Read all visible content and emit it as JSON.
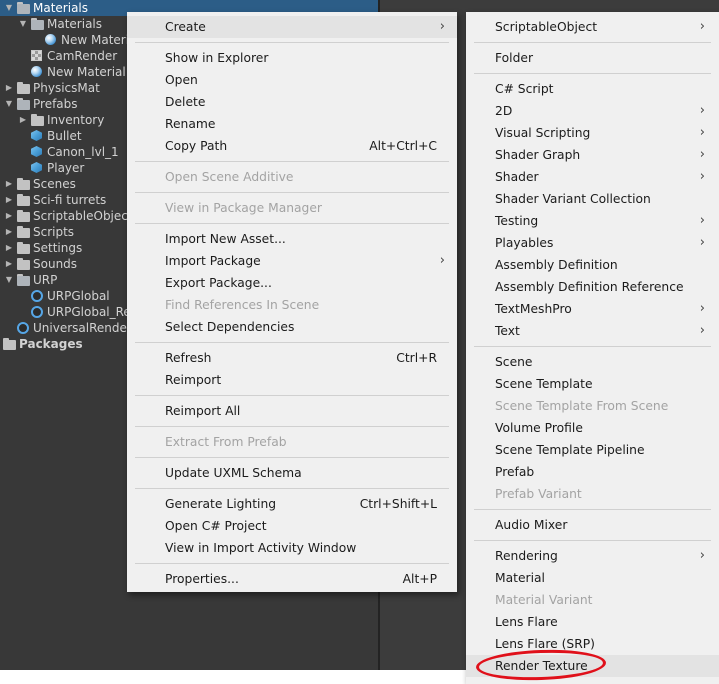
{
  "tree": [
    {
      "label": "Materials",
      "indent": 0,
      "arrow": "▼",
      "icon": "folder-open-icon",
      "selected": true
    },
    {
      "label": "Materials",
      "indent": 1,
      "arrow": "▼",
      "icon": "folder-open-icon"
    },
    {
      "label": "New Material",
      "indent": 2,
      "arrow": "",
      "icon": "material-sphere-icon"
    },
    {
      "label": "CamRender",
      "indent": 1,
      "arrow": "",
      "icon": "render-texture-icon"
    },
    {
      "label": "New Material",
      "indent": 1,
      "arrow": "",
      "icon": "material-sphere-icon"
    },
    {
      "label": "PhysicsMat",
      "indent": 0,
      "arrow": "▶",
      "icon": "folder-icon"
    },
    {
      "label": "Prefabs",
      "indent": 0,
      "arrow": "▼",
      "icon": "folder-open-icon"
    },
    {
      "label": "Inventory",
      "indent": 1,
      "arrow": "▶",
      "icon": "folder-icon"
    },
    {
      "label": "Bullet",
      "indent": 1,
      "arrow": "",
      "icon": "prefab-cube-icon"
    },
    {
      "label": "Canon_lvl_1",
      "indent": 1,
      "arrow": "",
      "icon": "prefab-cube-icon"
    },
    {
      "label": "Player",
      "indent": 1,
      "arrow": "",
      "icon": "prefab-cube-icon"
    },
    {
      "label": "Scenes",
      "indent": 0,
      "arrow": "▶",
      "icon": "folder-icon"
    },
    {
      "label": "Sci-fi turrets",
      "indent": 0,
      "arrow": "▶",
      "icon": "folder-icon"
    },
    {
      "label": "ScriptableObject",
      "indent": 0,
      "arrow": "▶",
      "icon": "folder-icon"
    },
    {
      "label": "Scripts",
      "indent": 0,
      "arrow": "▶",
      "icon": "folder-icon"
    },
    {
      "label": "Settings",
      "indent": 0,
      "arrow": "▶",
      "icon": "folder-icon"
    },
    {
      "label": "Sounds",
      "indent": 0,
      "arrow": "▶",
      "icon": "folder-icon"
    },
    {
      "label": "URP",
      "indent": 0,
      "arrow": "▼",
      "icon": "folder-open-icon"
    },
    {
      "label": "URPGlobal",
      "indent": 1,
      "arrow": "",
      "icon": "urp-asset-icon"
    },
    {
      "label": "URPGlobal_Re",
      "indent": 1,
      "arrow": "",
      "icon": "urp-asset-icon"
    },
    {
      "label": "UniversalRenderP",
      "indent": 0,
      "arrow": "",
      "icon": "urp-asset-icon"
    },
    {
      "label": "Packages",
      "indent": -1,
      "arrow": "",
      "icon": "folder-icon",
      "bold": true
    }
  ],
  "menu_left": [
    {
      "label": "Create",
      "submenu": true,
      "highlighted": true
    },
    {
      "sep": true
    },
    {
      "label": "Show in Explorer"
    },
    {
      "label": "Open"
    },
    {
      "label": "Delete"
    },
    {
      "label": "Rename"
    },
    {
      "label": "Copy Path",
      "shortcut": "Alt+Ctrl+C"
    },
    {
      "sep": true
    },
    {
      "label": "Open Scene Additive",
      "disabled": true
    },
    {
      "sep": true
    },
    {
      "label": "View in Package Manager",
      "disabled": true
    },
    {
      "sep": true
    },
    {
      "label": "Import New Asset..."
    },
    {
      "label": "Import Package",
      "submenu": true
    },
    {
      "label": "Export Package..."
    },
    {
      "label": "Find References In Scene",
      "disabled": true
    },
    {
      "label": "Select Dependencies"
    },
    {
      "sep": true
    },
    {
      "label": "Refresh",
      "shortcut": "Ctrl+R"
    },
    {
      "label": "Reimport"
    },
    {
      "sep": true
    },
    {
      "label": "Reimport All"
    },
    {
      "sep": true
    },
    {
      "label": "Extract From Prefab",
      "disabled": true
    },
    {
      "sep": true
    },
    {
      "label": "Update UXML Schema"
    },
    {
      "sep": true
    },
    {
      "label": "Generate Lighting",
      "shortcut": "Ctrl+Shift+L"
    },
    {
      "label": "Open C# Project"
    },
    {
      "label": "View in Import Activity Window"
    },
    {
      "sep": true
    },
    {
      "label": "Properties...",
      "shortcut": "Alt+P"
    }
  ],
  "menu_right": [
    {
      "label": "ScriptableObject",
      "submenu": true
    },
    {
      "sep": true
    },
    {
      "label": "Folder"
    },
    {
      "sep": true
    },
    {
      "label": "C# Script"
    },
    {
      "label": "2D",
      "submenu": true
    },
    {
      "label": "Visual Scripting",
      "submenu": true
    },
    {
      "label": "Shader Graph",
      "submenu": true
    },
    {
      "label": "Shader",
      "submenu": true
    },
    {
      "label": "Shader Variant Collection"
    },
    {
      "label": "Testing",
      "submenu": true
    },
    {
      "label": "Playables",
      "submenu": true
    },
    {
      "label": "Assembly Definition"
    },
    {
      "label": "Assembly Definition Reference"
    },
    {
      "label": "TextMeshPro",
      "submenu": true
    },
    {
      "label": "Text",
      "submenu": true
    },
    {
      "sep": true
    },
    {
      "label": "Scene"
    },
    {
      "label": "Scene Template"
    },
    {
      "label": "Scene Template From Scene",
      "disabled": true
    },
    {
      "label": "Volume Profile"
    },
    {
      "label": "Scene Template Pipeline"
    },
    {
      "label": "Prefab"
    },
    {
      "label": "Prefab Variant",
      "disabled": true
    },
    {
      "sep": true
    },
    {
      "label": "Audio Mixer"
    },
    {
      "sep": true
    },
    {
      "label": "Rendering",
      "submenu": true
    },
    {
      "label": "Material"
    },
    {
      "label": "Material Variant",
      "disabled": true
    },
    {
      "label": "Lens Flare"
    },
    {
      "label": "Lens Flare (SRP)"
    },
    {
      "label": "Render Texture",
      "highlighted": true
    }
  ],
  "annotation": {
    "color": "#e0101a",
    "target": "Render Texture"
  }
}
